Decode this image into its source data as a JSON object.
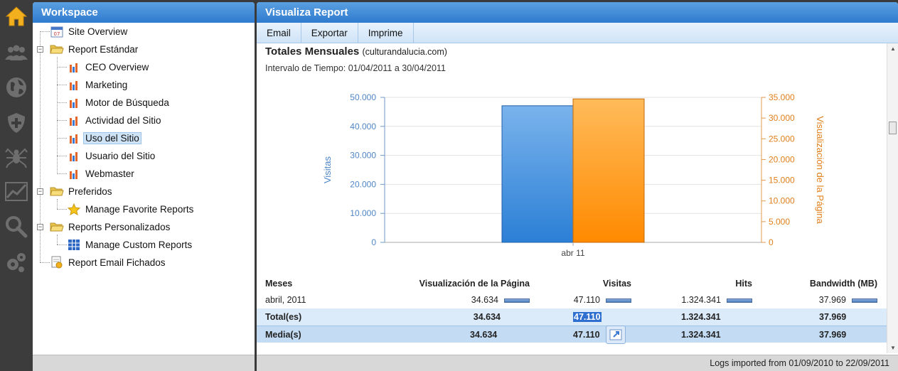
{
  "rail": {
    "items": [
      {
        "name": "home-icon",
        "active": true
      },
      {
        "name": "users-icon"
      },
      {
        "name": "globe-icon"
      },
      {
        "name": "shield-plus-icon"
      },
      {
        "name": "spider-icon"
      },
      {
        "name": "trend-chart-icon"
      },
      {
        "name": "search-icon"
      },
      {
        "name": "gears-icon"
      }
    ]
  },
  "workspace": {
    "title": "Workspace",
    "tree": {
      "site_overview": "Site Overview",
      "report_estandar": "Report Estándar",
      "ceo_overview": "CEO Overview",
      "marketing": "Marketing",
      "motor_busqueda": "Motor de Búsqueda",
      "actividad_sitio": "Actividad del Sitio",
      "uso_sitio": "Uso del Sitio",
      "usuario_sitio": "Usuario del Sitio",
      "webmaster": "Webmaster",
      "preferidos": "Preferidos",
      "manage_favorite": "Manage Favorite Reports",
      "reports_personalizados": "Reports Personalizados",
      "manage_custom": "Manage Custom Reports",
      "report_email": "Report Email Fichados"
    },
    "selected": "Uso del Sitio"
  },
  "report": {
    "title": "Visualiza Report",
    "toolbar": {
      "email": "Email",
      "exportar": "Exportar",
      "imprime": "Imprime"
    },
    "heading": "Totales Mensuales",
    "domain": "(culturandalucia.com)",
    "interval": "Intervalo de Tiempo:  01/04/2011 a 30/04/2011",
    "footer": "Logs imported from 01/09/2010 to 22/09/2011"
  },
  "chart_data": {
    "type": "bar",
    "categories": [
      "abr 11"
    ],
    "series": [
      {
        "name": "Visitas",
        "values": [
          47110
        ],
        "axis": "left",
        "color": "#3b8ede"
      },
      {
        "name": "Visualización de la Página",
        "values": [
          34634
        ],
        "axis": "right",
        "color": "#ff9a1a"
      }
    ],
    "ylabel": "Visitas",
    "y2label": "Visualización de la Página",
    "ylim": [
      0,
      50000
    ],
    "y2lim": [
      0,
      35000
    ],
    "yticks": [
      "0",
      "10.000",
      "20.000",
      "30.000",
      "40.000",
      "50.000"
    ],
    "y2ticks": [
      "0",
      "5.000",
      "10.000",
      "15.000",
      "20.000",
      "25.000",
      "30.000",
      "35.000"
    ],
    "grid": true
  },
  "table": {
    "headers": {
      "meses": "Meses",
      "vis_pagina": "Visualización de la Página",
      "visitas": "Visitas",
      "hits": "Hits",
      "bandwidth": "Bandwidth (MB)"
    },
    "rows": [
      {
        "mes": "abril, 2011",
        "vis_pagina": "34.634",
        "visitas": "47.110",
        "hits": "1.324.341",
        "bandwidth": "37.969"
      }
    ],
    "total": {
      "label": "Total(es)",
      "vis_pagina": "34.634",
      "visitas": "47.110",
      "hits": "1.324.341",
      "bandwidth": "37.969"
    },
    "media": {
      "label": "Media(s)",
      "vis_pagina": "34.634",
      "visitas": "47.110",
      "hits": "1.324.341",
      "bandwidth": "37.969"
    }
  }
}
